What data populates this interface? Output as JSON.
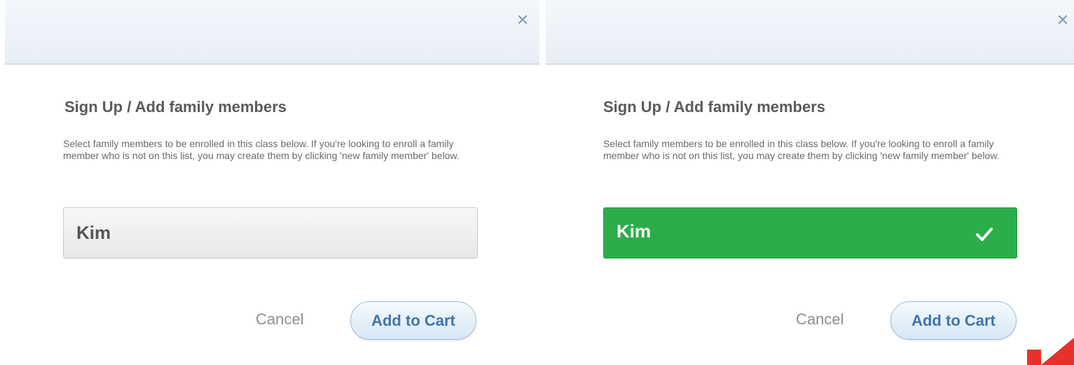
{
  "colors": {
    "selected_green": "#2bae4a",
    "button_blue_text": "#3d76ad",
    "close_icon": "#8a9bb3",
    "logo_red": "#e8312a"
  },
  "modals": [
    {
      "state": "unselected",
      "close_icon": "close-icon",
      "title": "Sign Up / Add family members",
      "description": "Select family members to be enrolled in this class below. If you're looking to enroll a family member who is not on this list, you may create them by clicking 'new family member' below.",
      "member": {
        "name": "Kim",
        "selected": false
      },
      "cancel_label": "Cancel",
      "add_to_cart_label": "Add to Cart"
    },
    {
      "state": "selected",
      "close_icon": "close-icon",
      "title": "Sign Up / Add family members",
      "description": "Select family members to be enrolled in this class below. If you're looking to enroll a family member who is not on this list, you may create them by clicking 'new family member' below.",
      "member": {
        "name": "Kim",
        "selected": true,
        "check_icon": "checkmark-icon"
      },
      "cancel_label": "Cancel",
      "add_to_cart_label": "Add to Cart"
    }
  ],
  "corner_logo": "logo-mark"
}
